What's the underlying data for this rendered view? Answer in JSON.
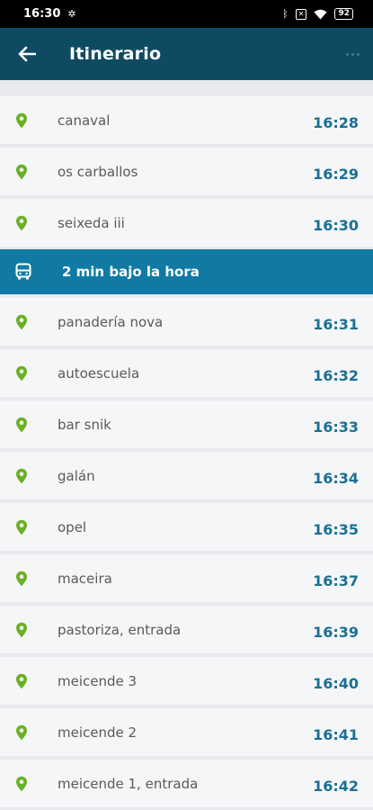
{
  "status_bar": {
    "time": "16:30",
    "battery": "92"
  },
  "app_bar": {
    "title": "Itinerario"
  },
  "stops_before": [
    {
      "name": "canaval",
      "time": "16:28"
    },
    {
      "name": "os carballos",
      "time": "16:29"
    },
    {
      "name": "seixeda iii",
      "time": "16:30"
    }
  ],
  "bus_banner": {
    "text": "2 min bajo la hora"
  },
  "stops_after": [
    {
      "name": "panadería nova",
      "time": "16:31"
    },
    {
      "name": "autoescuela",
      "time": "16:32"
    },
    {
      "name": "bar snik",
      "time": "16:33"
    },
    {
      "name": "galán",
      "time": "16:34"
    },
    {
      "name": "opel",
      "time": "16:35"
    },
    {
      "name": "maceira",
      "time": "16:37"
    },
    {
      "name": "pastoriza, entrada",
      "time": "16:39"
    },
    {
      "name": "meicende 3",
      "time": "16:40"
    },
    {
      "name": "meicende 2",
      "time": "16:41"
    },
    {
      "name": "meicende 1, entrada",
      "time": "16:42"
    }
  ],
  "colors": {
    "app_bar": "#0f4a63",
    "pin": "#6ab023",
    "time": "#1a6f93",
    "bus_banner": "#117aa4"
  }
}
